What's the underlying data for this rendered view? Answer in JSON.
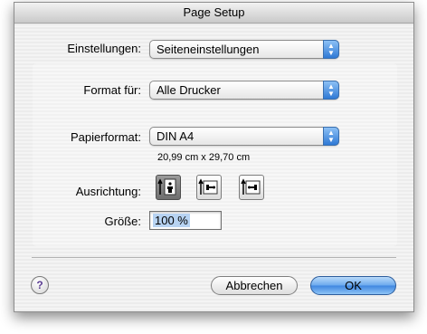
{
  "window": {
    "title": "Page Setup"
  },
  "settings": {
    "label": "Einstellungen:",
    "value": "Seiteneinstellungen"
  },
  "format_for": {
    "label": "Format für:",
    "value": "Alle Drucker"
  },
  "paper": {
    "label": "Papierformat:",
    "value": "DIN A4",
    "dimensions": "20,99 cm x 29,70 cm"
  },
  "orientation": {
    "label": "Ausrichtung:",
    "options": [
      "portrait-orientation-icon",
      "landscape-orientation-icon",
      "reverse-landscape-orientation-icon"
    ],
    "selected": "portrait-orientation-icon"
  },
  "scale": {
    "label": "Größe:",
    "value": "100 %"
  },
  "buttons": {
    "help": "?",
    "cancel": "Abbrechen",
    "ok": "OK"
  },
  "colors": {
    "accent": "#3e86e0",
    "background": "#ededed"
  }
}
